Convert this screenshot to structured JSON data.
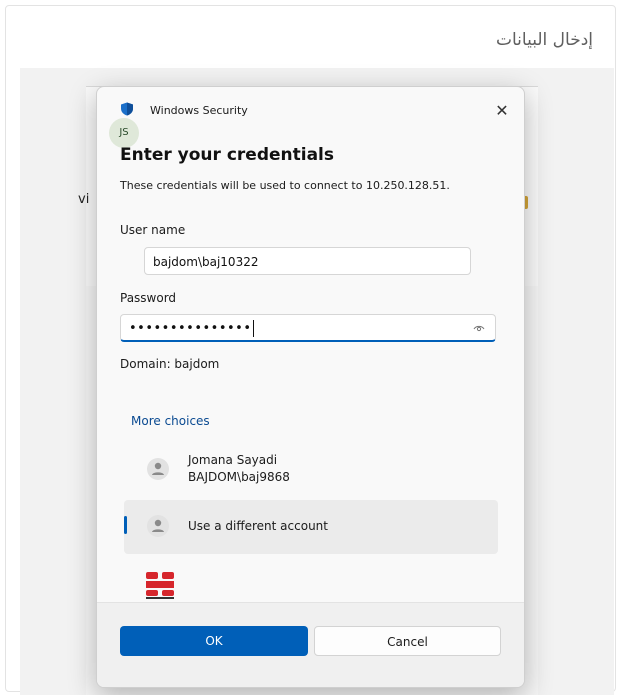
{
  "page": {
    "title": "إدخال البيانات",
    "bg_fragment": "vi"
  },
  "dialog": {
    "app_name": "Windows Security",
    "avatar_initials": "JS",
    "close_glyph": "✕",
    "title": "Enter your credentials",
    "description": "These credentials will be used to connect to 10.250.128.51.",
    "username_label": "User name",
    "username_value": "bajdom\\baj10322",
    "password_label": "Password",
    "password_masked": "•••••••••••••••",
    "domain_text": "Domain: bajdom",
    "more_choices": "More choices",
    "accounts": [
      {
        "name": "Jomana Sayadi",
        "id": "BAJDOM\\baj9868",
        "selected": false
      },
      {
        "name": "Use a different account",
        "selected": true
      }
    ],
    "ok_label": "OK",
    "cancel_label": "Cancel"
  },
  "colors": {
    "accent": "#005fb8",
    "link": "#0a4a91",
    "fortinet": "#d6262c"
  }
}
